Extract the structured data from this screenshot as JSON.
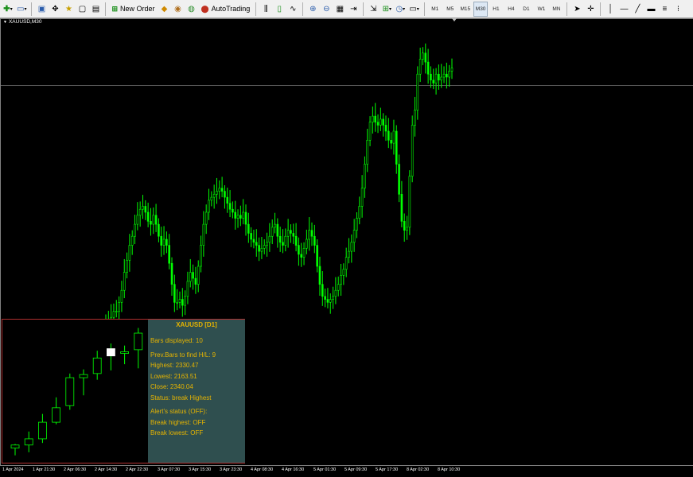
{
  "toolbar": {
    "new_order_label": "New Order",
    "autotrading_label": "AutoTrading",
    "timeframes": [
      "M1",
      "M5",
      "M15",
      "M30",
      "H1",
      "H4",
      "D1",
      "W1",
      "MN"
    ]
  },
  "chart": {
    "title": "XAUUSD,M30",
    "candle_color": "#00ff00",
    "background_color": "#000000",
    "grid": false,
    "axis_labels": [
      "1 Apr 2024",
      "1 Apr 21:30",
      "2 Apr 06:30",
      "2 Apr 14:30",
      "2 Apr 22:30",
      "3 Apr 07:30",
      "3 Apr 15:30",
      "3 Apr 23:30",
      "4 Apr 08:30",
      "4 Apr 16:30",
      "5 Apr 01:30",
      "5 Apr 09:30",
      "5 Apr 17:30",
      "8 Apr 02:30",
      "8 Apr 10:30"
    ]
  },
  "panel": {
    "title": "XAUUSD [D1]",
    "bars_displayed": "Bars displayed: 10",
    "prev_bars": "Prev.Bars to find H/L: 9",
    "highest": "Highest: 2330.47",
    "lowest": "Lowest: 2163.51",
    "close": "Close: 2340.04",
    "status": "Status: break Highest",
    "alert_status": "Alert's status (OFF):",
    "break_highest": "Break highest: OFF",
    "break_lowest": "Break lowest: OFF",
    "border_color": "#b03030",
    "info_bg": "#2f4f4f",
    "text_color": "#e6b400"
  },
  "chart_data": {
    "type": "candlestick",
    "series": [
      {
        "values": [
          0.3,
          0.29,
          0.31,
          0.33,
          0.33,
          0.36,
          0.4,
          0.46,
          0.5,
          0.55,
          0.58,
          0.62,
          0.65,
          0.67,
          0.68,
          0.66,
          0.63,
          0.62,
          0.65,
          0.62,
          0.58,
          0.55,
          0.57,
          0.55,
          0.49,
          0.42,
          0.36,
          0.36,
          0.37,
          0.35,
          0.38,
          0.43,
          0.46,
          0.44,
          0.42,
          0.48,
          0.55,
          0.62,
          0.66,
          0.7,
          0.71,
          0.72,
          0.73,
          0.74,
          0.73,
          0.71,
          0.69,
          0.67,
          0.66,
          0.64,
          0.65,
          0.64,
          0.66,
          0.62,
          0.59,
          0.57,
          0.56,
          0.55,
          0.53,
          0.54,
          0.55,
          0.56,
          0.58,
          0.61,
          0.62,
          0.58,
          0.56,
          0.55,
          0.58,
          0.6,
          0.59,
          0.58,
          0.55,
          0.52,
          0.51,
          0.54,
          0.57,
          0.6,
          0.58,
          0.55,
          0.48,
          0.42,
          0.38,
          0.37,
          0.36,
          0.37,
          0.38,
          0.4,
          0.42,
          0.45,
          0.47,
          0.51,
          0.53,
          0.56,
          0.6,
          0.64,
          0.68,
          0.74,
          0.82,
          0.9,
          0.96,
          0.98,
          0.96,
          0.95,
          0.97,
          0.95,
          0.93,
          0.9,
          0.89,
          0.93,
          0.82,
          0.72,
          0.63,
          0.6,
          0.61,
          0.78,
          0.95,
          1.0,
          1.12,
          1.17,
          1.19,
          1.16,
          1.12,
          1.1,
          1.09,
          1.12,
          1.1,
          1.11,
          1.12,
          1.11,
          1.13,
          1.14
        ]
      }
    ],
    "ylim": [
      0.3,
      1.2
    ]
  },
  "panel_chart_data": {
    "type": "candlestick",
    "candles": [
      {
        "o": 2229,
        "h": 2233,
        "l": 2222,
        "c": 2232
      },
      {
        "o": 2232,
        "h": 2245,
        "l": 2225,
        "c": 2238
      },
      {
        "o": 2238,
        "h": 2262,
        "l": 2234,
        "c": 2254
      },
      {
        "o": 2254,
        "h": 2278,
        "l": 2252,
        "c": 2268
      },
      {
        "o": 2270,
        "h": 2301,
        "l": 2266,
        "c": 2297
      },
      {
        "o": 2297,
        "h": 2305,
        "l": 2280,
        "c": 2300
      },
      {
        "o": 2301,
        "h": 2323,
        "l": 2295,
        "c": 2316
      },
      {
        "o": 2318,
        "h": 2330,
        "l": 2304,
        "c": 2325
      },
      {
        "o": 2321,
        "h": 2328,
        "l": 2310,
        "c": 2322
      },
      {
        "o": 2324,
        "h": 2345,
        "l": 2306,
        "c": 2340
      }
    ]
  }
}
